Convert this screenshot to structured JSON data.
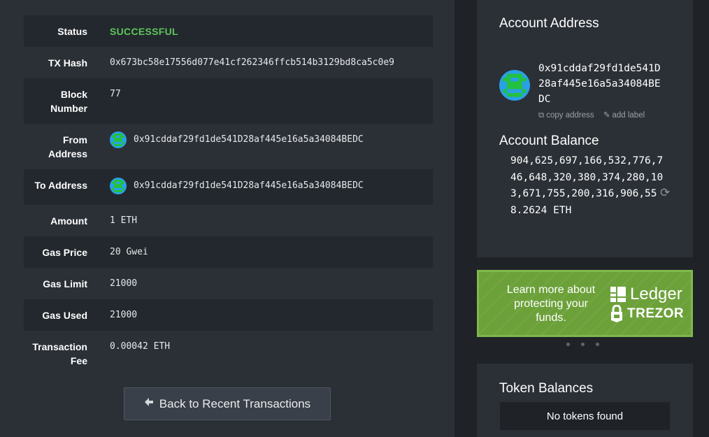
{
  "transaction": {
    "rows": [
      {
        "label": "Status",
        "value": "SUCCESSFUL"
      },
      {
        "label": "TX Hash",
        "value": "0x673bc58e17556d077e41cf262346ffcb514b3129bd8ca5c0e9"
      },
      {
        "label": "Block Number",
        "value": "77"
      },
      {
        "label": "From Address",
        "value": "0x91cddaf29fd1de541D28af445e16a5a34084BEDC"
      },
      {
        "label": "To Address",
        "value": "0x91cddaf29fd1de541D28af445e16a5a34084BEDC"
      },
      {
        "label": "Amount",
        "value": "1 ETH"
      },
      {
        "label": "Gas Price",
        "value": "20 Gwei"
      },
      {
        "label": "Gas Limit",
        "value": "21000"
      },
      {
        "label": "Gas Used",
        "value": "21000"
      },
      {
        "label": "Transaction Fee",
        "value": "0.00042 ETH"
      }
    ],
    "back_button_label": "Back to Recent Transactions",
    "back_icon": "arrow-left-icon"
  },
  "account": {
    "title": "Account Address",
    "address": "0x91cddaf29fd1de541D28af445e16a5a34084BEDC",
    "copy_label": "copy address",
    "add_label": "add label",
    "balance_title": "Account Balance",
    "balance": "904,625,697,166,532,776,746,648,320,380,374,280,103,671,755,200,316,906,558.2624 ETH"
  },
  "promo": {
    "text": "Learn more about protecting your funds.",
    "ledger": "Ledger",
    "trezor": "TREZOR"
  },
  "tokens": {
    "title": "Token Balances",
    "empty": "No tokens found"
  },
  "colors": {
    "success": "#5ec55a",
    "promo_green": "#6ca13a",
    "identicon_blue": "#2aa0e8",
    "identicon_green": "#22c140"
  }
}
